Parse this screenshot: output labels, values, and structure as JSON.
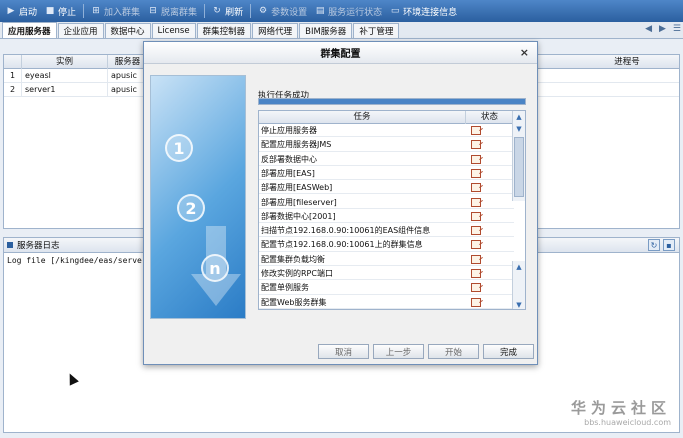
{
  "toolbar": {
    "items": [
      {
        "label": "启动",
        "icon": "play-icon",
        "enabled": true
      },
      {
        "label": "停止",
        "icon": "stop-icon",
        "enabled": true
      },
      {
        "label": "加入群集",
        "icon": "join-cluster-icon",
        "enabled": false
      },
      {
        "label": "脱离群集",
        "icon": "leave-cluster-icon",
        "enabled": false
      },
      {
        "label": "刷新",
        "icon": "refresh-icon",
        "enabled": true
      },
      {
        "label": "参数设置",
        "icon": "settings-icon",
        "enabled": false
      },
      {
        "label": "服务运行状态",
        "icon": "status-icon",
        "enabled": false
      },
      {
        "label": "环境连接信息",
        "icon": "connection-icon",
        "enabled": true
      }
    ]
  },
  "tabs": [
    "应用服务器",
    "企业应用",
    "数据中心",
    "License",
    "群集控制器",
    "网络代理",
    "BIM服务器",
    "补丁管理"
  ],
  "active_tab": "应用服务器",
  "server_table": {
    "columns": [
      "实例",
      "服务器",
      "进程号"
    ],
    "rows": [
      {
        "index": "1",
        "instance": "eyeasl",
        "server": "apusic"
      },
      {
        "index": "2",
        "instance": "server1",
        "server": "apusic"
      }
    ]
  },
  "log": {
    "title": "服务器日志",
    "text": "Log file [/kingdee/eas/server/pr"
  },
  "dialog": {
    "title": "群集配置",
    "close": "×",
    "status_message": "执行任务成功",
    "progress_percent": 100,
    "task_columns": [
      "任务",
      "状态"
    ],
    "tasks": [
      "停止应用服务器",
      "配置应用服务器JMS",
      "反部署数据中心",
      "部署应用[EAS]",
      "部署应用[EASWeb]",
      "部署应用[fileserver]",
      "部署数据中心[2001]",
      "扫描节点192.168.0.90:10061的EAS组件信息",
      "配置节点192.168.0.90:10061上的群集信息",
      "配置集群负载均衡",
      "修改实例的RPC端口",
      "配置单例服务",
      "配置Web服务群集"
    ],
    "art_numbers": [
      "1",
      "2",
      "n"
    ],
    "buttons": {
      "cancel": "取消",
      "prev": "上一步",
      "start": "开始",
      "finish": "完成"
    }
  },
  "watermark": {
    "main": "华为云社区",
    "sub": "bbs.huaweicloud.com"
  },
  "colors": {
    "toolbar": "#2b5f9f",
    "progress": "#4a84c5"
  }
}
